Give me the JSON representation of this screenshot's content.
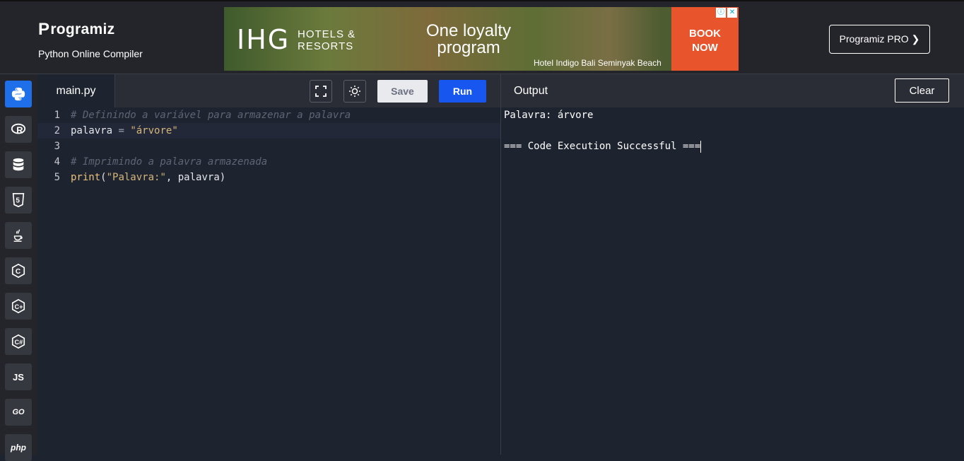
{
  "brand": {
    "logo_text": "rogramiz",
    "logo_initial": "P",
    "subtitle": "Python Online Compiler"
  },
  "ad": {
    "brand": "IHG",
    "brand_line1": "HOTELS &",
    "brand_line2": "RESORTS",
    "headline_line1": "One loyalty",
    "headline_line2": "program",
    "hotel_name": "Hotel Indigo Bali Seminyak Beach",
    "cta_line1": "BOOK",
    "cta_line2": "NOW"
  },
  "header": {
    "pro_button": "Programiz PRO ❯"
  },
  "sidebar": {
    "languages": [
      {
        "name": "python",
        "icon": "python-icon",
        "active": true
      },
      {
        "name": "r",
        "icon": "r-icon"
      },
      {
        "name": "sql",
        "icon": "database-icon"
      },
      {
        "name": "html",
        "icon": "html5-icon"
      },
      {
        "name": "java",
        "icon": "java-icon"
      },
      {
        "name": "c",
        "icon": "c-icon"
      },
      {
        "name": "cpp",
        "icon": "cpp-icon"
      },
      {
        "name": "csharp",
        "icon": "csharp-icon"
      },
      {
        "name": "js",
        "label": "JS"
      },
      {
        "name": "go",
        "label": "GO"
      },
      {
        "name": "php",
        "label": "php"
      }
    ]
  },
  "editor": {
    "tab_label": "main.py",
    "save_label": "Save",
    "run_label": "Run",
    "lines": [
      {
        "number": "1",
        "comment": "# Definindo a variável para armazenar a palavra"
      },
      {
        "number": "2",
        "var": "palavra",
        "op": " = ",
        "str": "\"árvore\""
      },
      {
        "number": "3"
      },
      {
        "number": "4",
        "comment": "# Imprimindo a palavra armazenada"
      },
      {
        "number": "5",
        "fn": "print",
        "open": "(",
        "str": "\"Palavra:\"",
        "rest": ", palavra)"
      }
    ]
  },
  "output": {
    "title": "Output",
    "clear_label": "Clear",
    "lines": [
      "Palavra: árvore",
      "",
      "=== Code Execution Successful ==="
    ]
  }
}
